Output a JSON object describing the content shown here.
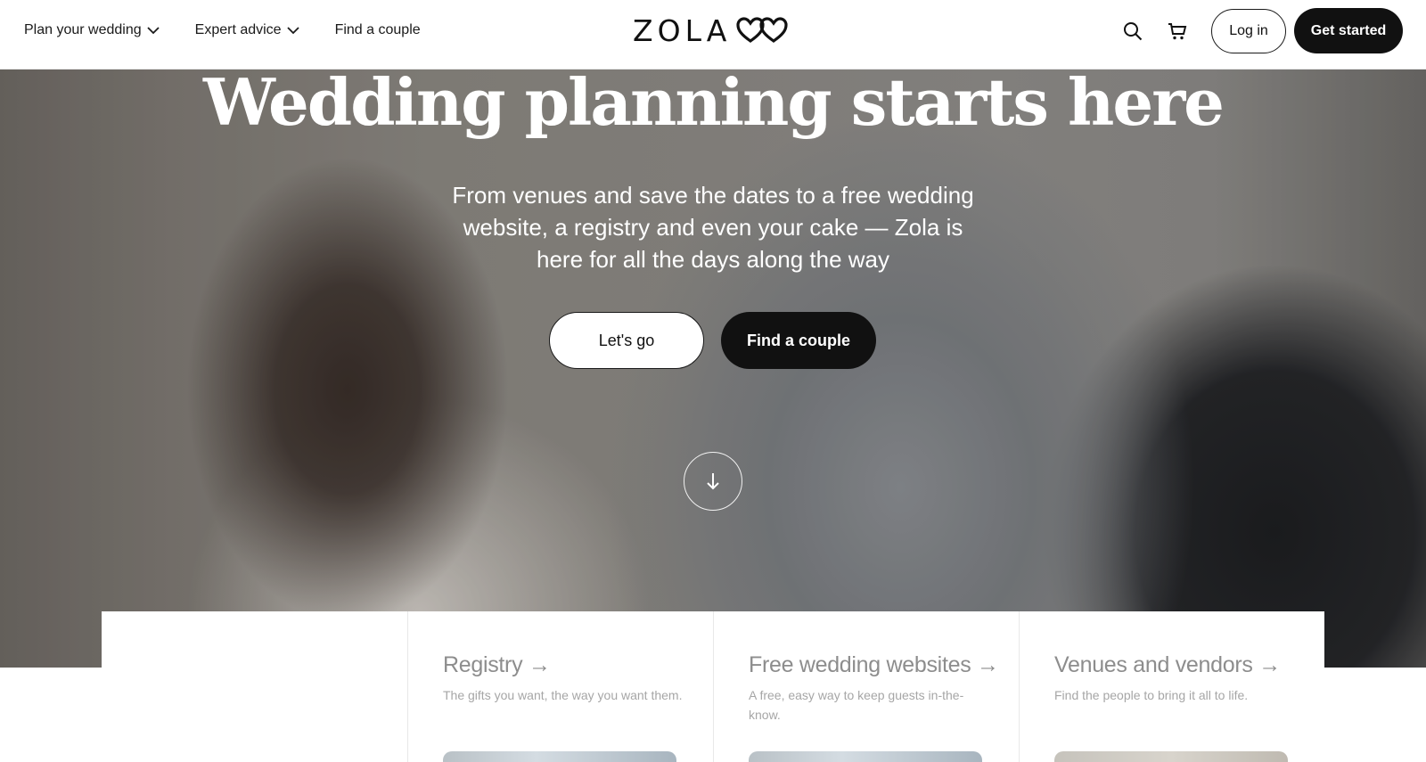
{
  "header": {
    "nav": [
      {
        "label": "Plan your wedding",
        "has_dropdown": true
      },
      {
        "label": "Expert advice",
        "has_dropdown": true
      },
      {
        "label": "Find a couple",
        "has_dropdown": false
      }
    ],
    "logo_text": "ZOLA",
    "logo_mark": "interlocking-hearts",
    "search_icon": "search-icon",
    "cart_icon": "cart-icon",
    "login_label": "Log in",
    "get_started_label": "Get started"
  },
  "hero": {
    "title": "Wedding planning starts here",
    "subtitle": "From venues and save the dates to a free wedding website, a registry and even your cake — Zola is here for all the days along the way",
    "primary_cta": "Let's go",
    "secondary_cta": "Find a couple",
    "scroll_icon": "arrow-down-icon"
  },
  "cards": [
    {
      "title": "Registry",
      "arrow": "→",
      "description": "The gifts you want, the way you want them."
    },
    {
      "title": "Free wedding websites",
      "arrow": "→",
      "description": "A free, easy way to keep guests in-the-know."
    },
    {
      "title": "Venues and vendors",
      "arrow": "→",
      "description": "Find the people to bring it all to life."
    }
  ],
  "colors": {
    "primary_dark": "#111111",
    "white": "#ffffff",
    "muted_text": "#8d8d8d"
  }
}
